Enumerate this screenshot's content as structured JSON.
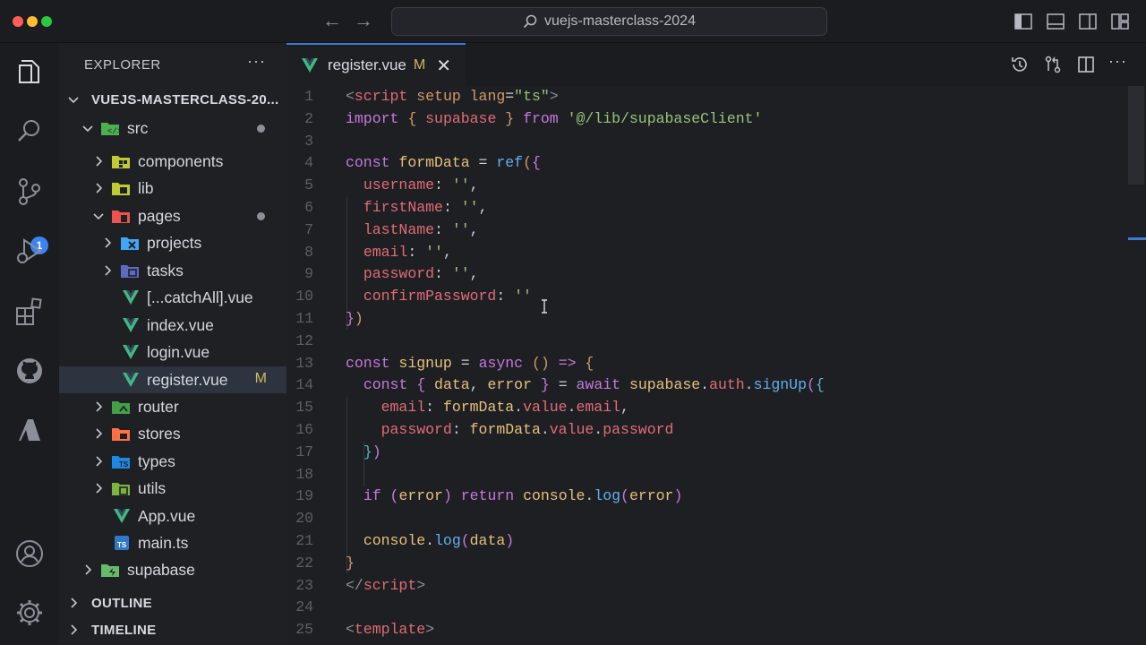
{
  "window": {
    "search": "vuejs-masterclass-2024"
  },
  "activity": {
    "source_control_badge": "1"
  },
  "sidebar": {
    "title": "EXPLORER",
    "more": "···",
    "root": "VUEJS-MASTERCLASS-20...",
    "items": [
      {
        "label": "src",
        "type": "folder-open",
        "icon": "src-folder-icon",
        "color": "#4caf50"
      },
      {
        "label": "components",
        "type": "folder",
        "icon": "components-folder-icon",
        "color": "#c0ca33"
      },
      {
        "label": "lib",
        "type": "folder",
        "icon": "lib-folder-icon",
        "color": "#c0ca33"
      },
      {
        "label": "pages",
        "type": "folder-open",
        "icon": "pages-folder-icon",
        "color": "#ef5350"
      },
      {
        "label": "projects",
        "type": "folder",
        "icon": "projects-folder-icon",
        "color": "#42a5f5"
      },
      {
        "label": "tasks",
        "type": "folder",
        "icon": "tasks-folder-icon",
        "color": "#5c6bc0"
      },
      {
        "label": "[...catchAll].vue",
        "type": "vue",
        "icon": "vue-file-icon"
      },
      {
        "label": "index.vue",
        "type": "vue",
        "icon": "vue-file-icon"
      },
      {
        "label": "login.vue",
        "type": "vue",
        "icon": "vue-file-icon"
      },
      {
        "label": "register.vue",
        "type": "vue",
        "icon": "vue-file-icon",
        "status": "M"
      },
      {
        "label": "router",
        "type": "folder",
        "icon": "router-folder-icon",
        "color": "#43a047"
      },
      {
        "label": "stores",
        "type": "folder",
        "icon": "stores-folder-icon",
        "color": "#ff7043"
      },
      {
        "label": "types",
        "type": "folder",
        "icon": "types-folder-icon",
        "color": "#1e88e5"
      },
      {
        "label": "utils",
        "type": "folder",
        "icon": "utils-folder-icon",
        "color": "#7cb342"
      },
      {
        "label": "App.vue",
        "type": "vue",
        "icon": "vue-file-icon"
      },
      {
        "label": "main.ts",
        "type": "ts",
        "icon": "ts-file-icon"
      },
      {
        "label": "supabase",
        "type": "folder",
        "icon": "supabase-folder-icon",
        "color": "#66bb6a"
      }
    ],
    "outline": "OUTLINE",
    "timeline": "TIMELINE"
  },
  "editor": {
    "tab_label": "register.vue",
    "tab_status": "M",
    "tab_close": "✕",
    "more": "···",
    "line_numbers": [
      "1",
      "2",
      "3",
      "4",
      "5",
      "6",
      "7",
      "8",
      "9",
      "10",
      "11",
      "12",
      "13",
      "14",
      "15",
      "16",
      "17",
      "18",
      "19",
      "20",
      "21",
      "22",
      "23",
      "24",
      "25"
    ]
  },
  "colors": {
    "accent": "#3a7bd5",
    "modified": "#d0b85e",
    "vue_green": "#41b883",
    "badge": "#3b82f6"
  }
}
